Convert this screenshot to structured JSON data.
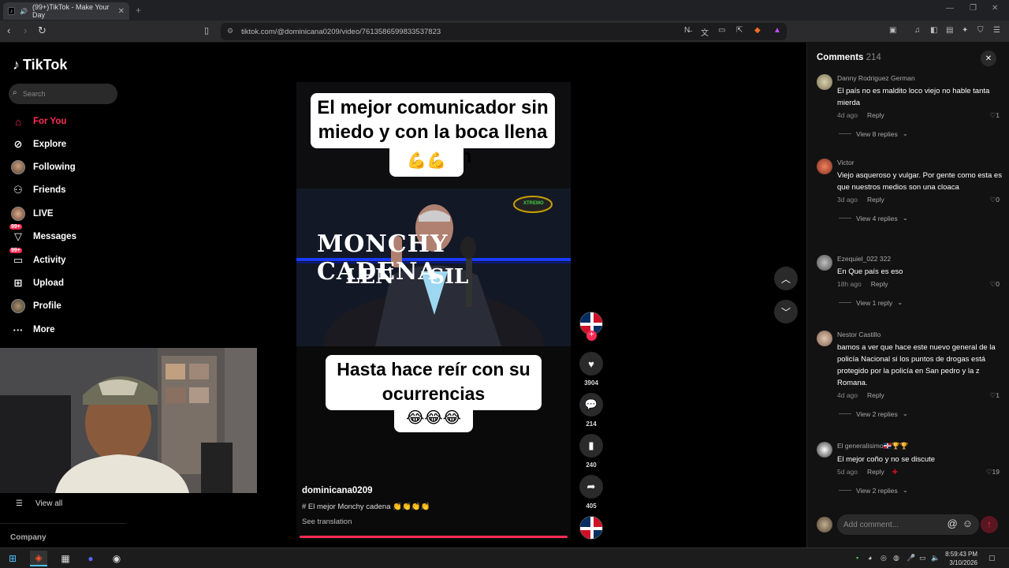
{
  "browser": {
    "tab_title": "(99+)TikTok - Make Your Day",
    "tab_close": "✕",
    "new_tab": "+",
    "url": "tiktok.com/@dominicana0209/video/7613586599833537823"
  },
  "sidebar": {
    "brand": "TikTok",
    "search_placeholder": "Search",
    "items": [
      {
        "label": "For You",
        "icon": "home-icon",
        "active": true
      },
      {
        "label": "Explore",
        "icon": "compass-icon"
      },
      {
        "label": "Following",
        "icon": "following-avatar-icon"
      },
      {
        "label": "Friends",
        "icon": "friends-icon"
      },
      {
        "label": "LIVE",
        "icon": "live-icon"
      },
      {
        "label": "Messages",
        "icon": "messages-icon",
        "badge": "99+"
      },
      {
        "label": "Activity",
        "icon": "activity-icon",
        "badge": "99+"
      },
      {
        "label": "Upload",
        "icon": "upload-icon"
      },
      {
        "label": "Profile",
        "icon": "profile-avatar-icon"
      },
      {
        "label": "More",
        "icon": "more-icon"
      }
    ],
    "view_all": "View all",
    "company": "Company"
  },
  "video": {
    "caption_top": "El mejor comunicador sin miedo y con la boca llena de razón",
    "caption_top_emoji": "💪💪",
    "banner_line1": "MONCHY CADENA",
    "banner_line2": "LEN     SIL",
    "channel_logo": "XTREMO",
    "caption_bottom": "Hasta hace reír con su ocurrencias",
    "caption_bottom_emoji": "😂😂😂",
    "author": "dominicana0209",
    "description": "# El mejor Monchy cadena 👏👏👏👏",
    "see_translation": "See translation",
    "progress": 1.0
  },
  "actions": {
    "likes": "3904",
    "comments": "214",
    "saves": "240",
    "shares": "405"
  },
  "comments_panel": {
    "title": "Comments",
    "count": "214",
    "items": [
      {
        "name": "Danny Rodriguez German",
        "text": "El país no es maldito loco viejo no hable tanta mierda",
        "time": "4d ago",
        "likes": "1",
        "replies": "View 8 replies"
      },
      {
        "name": "Victor",
        "text": "Viejo asqueroso y vulgar. Por gente como esta es que nuestros medios son una cloaca",
        "time": "3d ago",
        "likes": "0",
        "replies": "View 4 replies"
      },
      {
        "name": "Ezequiel_022 322",
        "text": "En Que país es eso",
        "time": "18h ago",
        "likes": "0",
        "replies": "View 1 reply"
      },
      {
        "name": "Nestor Castillo",
        "text": "bamos a ver que hace este nuevo general de la policía Nacional si los puntos de drogas está protegido por la policía en San pedro y la z Romana.",
        "time": "4d ago",
        "likes": "1",
        "replies": "View 2 replies"
      },
      {
        "name": "El generalísimo🇩🇴🏆🏆",
        "text": "El mejor coño y no se discute",
        "time": "5d ago",
        "likes": "19",
        "replies": "View 2 replies"
      }
    ],
    "reply_label": "Reply",
    "add_comment_placeholder": "Add comment..."
  },
  "taskbar": {
    "time": "8:59:43 PM",
    "date": "3/10/2026"
  },
  "colors": {
    "accent": "#fe2c55",
    "background": "#000000",
    "panel": "#121212"
  }
}
